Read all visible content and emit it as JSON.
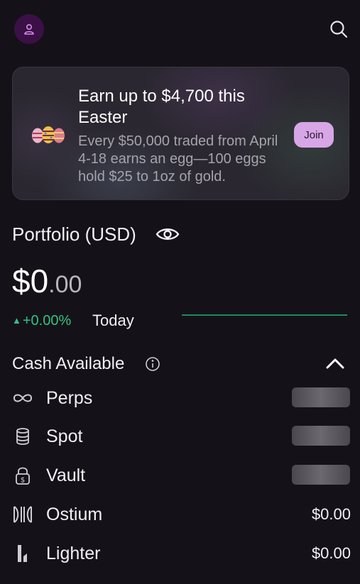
{
  "header": {
    "avatar_icon": "user-icon",
    "search_icon": "search-icon"
  },
  "promo": {
    "title": "Earn up to $4,700 this Easter",
    "body": "Every $50,000 traded from April 4-18 earns an egg—100 eggs hold $25 to 1oz of gold.",
    "join_label": "Join",
    "image": "easter-eggs"
  },
  "portfolio": {
    "label": "Portfolio (USD)",
    "visibility_icon": "eye-icon",
    "balance_major": "$0",
    "balance_minor": ".00",
    "change": "+0.00%",
    "period": "Today"
  },
  "cash": {
    "label": "Cash Available",
    "info_icon": "info-icon",
    "collapse_icon": "chevron-up-icon",
    "rows": [
      {
        "label": "Perps",
        "icon": "infinity-icon",
        "value": null,
        "masked": true
      },
      {
        "label": "Spot",
        "icon": "database-icon",
        "value": null,
        "masked": true
      },
      {
        "label": "Vault",
        "icon": "lock-dollar-icon",
        "value": null,
        "masked": true
      },
      {
        "label": "Ostium",
        "icon": "ostium-icon",
        "value": "$0.00",
        "masked": false
      },
      {
        "label": "Lighter",
        "icon": "lighter-icon",
        "value": "$0.00",
        "masked": false
      }
    ]
  },
  "colors": {
    "background": "#141218",
    "positive": "#34c185",
    "accent": "#d7a6e6",
    "avatar_bg": "#3b1046"
  }
}
